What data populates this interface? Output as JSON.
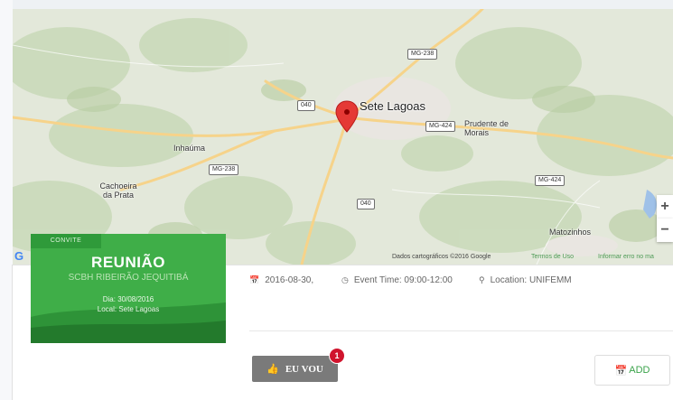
{
  "map": {
    "city_label": "Sete Lagoas",
    "places": [
      "Inhaúma",
      "Cachoeira da Prata",
      "Prudente de Morais",
      "Matozinhos"
    ],
    "roads": [
      "MG-238",
      "040",
      "MG-424",
      "MG-238",
      "040",
      "MG-424"
    ],
    "zoom_in": "+",
    "zoom_out": "−",
    "attribution": "Dados cartográficos ©2016 Google",
    "terms": "Termos de Uso",
    "report": "Informar erro no ma",
    "google_letter": "G"
  },
  "poster": {
    "tag": "CONVITE",
    "title": "REUNIÃO",
    "subtitle": "SCBH RIBEIRÃO JEQUITIBÁ",
    "date_line": "Dia: 30/08/2016",
    "local_line": "Local: Sete Lagoas"
  },
  "event": {
    "date": "2016-08-30,",
    "time": "Event Time: 09:00-12:00",
    "location": "Location: UNIFEMM"
  },
  "actions": {
    "going_label": "EU VOU",
    "going_count": "1",
    "add_label": "ADD"
  },
  "colors": {
    "accent": "#3fae48",
    "badge": "#d0142d",
    "going_button": "#7a7a7a",
    "pin": "#e53935"
  }
}
